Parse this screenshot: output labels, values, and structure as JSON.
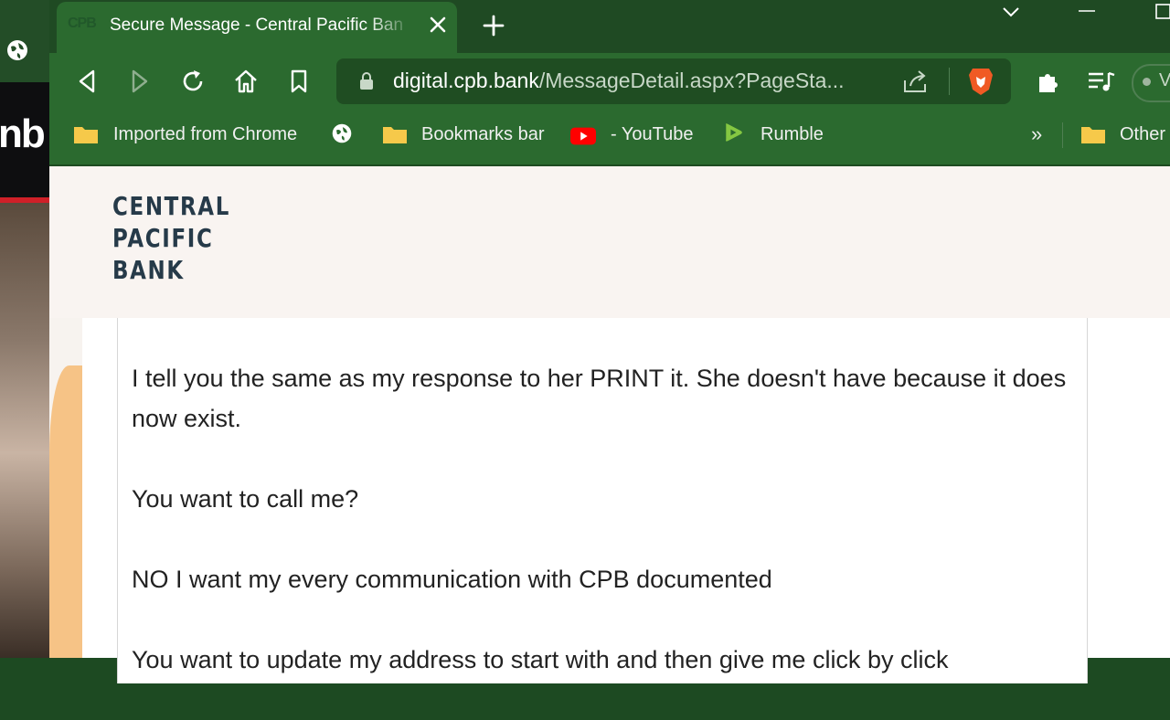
{
  "browser": {
    "tab": {
      "favicon_text": "CPB",
      "title": "Secure Message - Central Pacific Ban"
    },
    "url": {
      "host": "digital.cpb.bank",
      "path": "/MessageDetail.aspx?PageSta..."
    },
    "profile_letter": "V",
    "bookmarks": [
      {
        "label": "Imported from Chrome",
        "icon": "folder-icon"
      },
      {
        "label": "",
        "icon": "globe-icon"
      },
      {
        "label": "Bookmarks bar",
        "icon": "folder-icon"
      },
      {
        "label": "- YouTube",
        "icon": "youtube-icon"
      },
      {
        "label": "Rumble",
        "icon": "rumble-icon"
      },
      {
        "label": "Other",
        "icon": "folder-icon"
      }
    ],
    "overflow_label": "»"
  },
  "sidebar_overlay": {
    "text": "nb"
  },
  "page": {
    "logo_lines": [
      "CENTRAL",
      "PACIFIC",
      "BANK"
    ],
    "message_paragraphs": [
      "I tell you the same as my response to her PRINT it. She doesn't have because it does now exist.",
      "You want to call me?",
      "NO I want my every communication with CPB documented",
      "You want to update my address to start with and then give me click by click"
    ]
  },
  "colors": {
    "tab_strip": "#1f4a23",
    "toolbar": "#2b6a2f",
    "url_bar": "#1f4d22",
    "header_bg": "#f9f4f1",
    "logo": "#263a49",
    "accent_peach": "#f6c386"
  }
}
